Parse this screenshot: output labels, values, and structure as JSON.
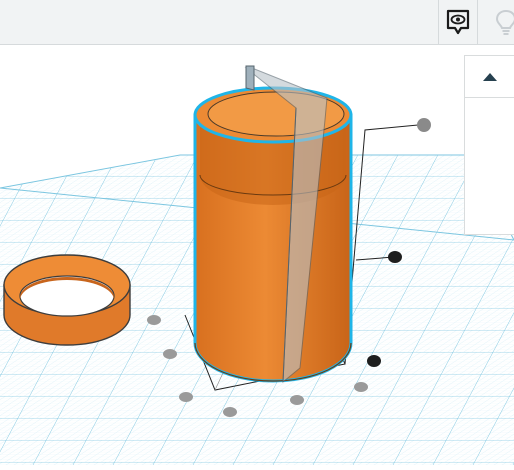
{
  "toolbar": {
    "view_toggle_icon": "eye-speech-bubble-icon",
    "hint_icon": "lightbulb-icon"
  },
  "side_panel": {
    "collapse_icon": "caret-up-icon"
  },
  "scene": {
    "objects": [
      {
        "name": "cylinder",
        "color": "#e8832e",
        "selected": true
      },
      {
        "name": "ring",
        "color": "#e8832e",
        "selected": false
      },
      {
        "name": "workplane-ruler",
        "color": "#9aaab5"
      }
    ],
    "grid_color": "#9fd8ec",
    "selection_outline": "#1fb5e8"
  }
}
